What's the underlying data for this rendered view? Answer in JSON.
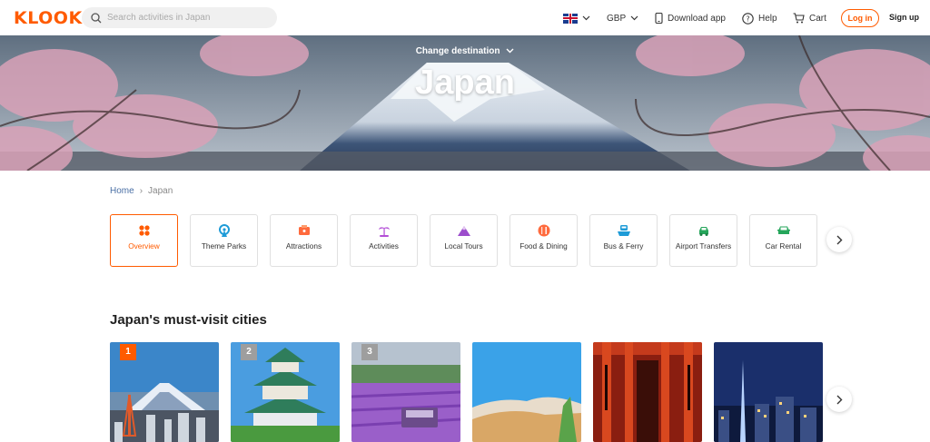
{
  "header": {
    "logo": "KLOOK",
    "search_placeholder": "Search activities in Japan",
    "currency": "GBP",
    "download_app": "Download app",
    "help": "Help",
    "cart": "Cart",
    "login": "Log in",
    "signup": "Sign up"
  },
  "hero": {
    "change_destination": "Change destination",
    "title": "Japan"
  },
  "breadcrumb": {
    "home": "Home",
    "separator": "›",
    "current": "Japan"
  },
  "categories": [
    {
      "label": "Overview",
      "icon": "overview-icon",
      "color": "#ff5b00"
    },
    {
      "label": "Theme Parks",
      "icon": "ferris-wheel-icon",
      "color": "#1e9bd7"
    },
    {
      "label": "Attractions",
      "icon": "ticket-icon",
      "color": "#ff6a3d"
    },
    {
      "label": "Activities",
      "icon": "palm-tree-icon",
      "color": "#b34fd6"
    },
    {
      "label": "Local Tours",
      "icon": "mountain-icon",
      "color": "#9c4dcc"
    },
    {
      "label": "Food & Dining",
      "icon": "dining-icon",
      "color": "#ff6a3d"
    },
    {
      "label": "Bus & Ferry",
      "icon": "ferry-icon",
      "color": "#1e9bd7"
    },
    {
      "label": "Airport Transfers",
      "icon": "car-icon",
      "color": "#26a65b"
    },
    {
      "label": "Car Rental",
      "icon": "car-rental-icon",
      "color": "#26a65b"
    }
  ],
  "section": {
    "title": "Japan's must-visit cities"
  },
  "cities": [
    {
      "rank": "1",
      "rank_color": "#ff5b00"
    },
    {
      "rank": "2",
      "rank_color": "#9e9e9e"
    },
    {
      "rank": "3",
      "rank_color": "#9e9e9e"
    },
    {
      "rank": ""
    },
    {
      "rank": ""
    },
    {
      "rank": ""
    }
  ],
  "colors": {
    "brand": "#ff5b00"
  }
}
